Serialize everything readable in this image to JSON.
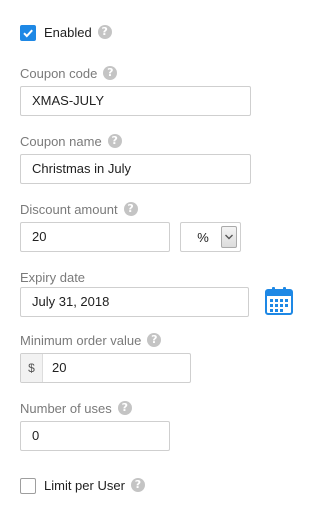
{
  "enabled": {
    "label": "Enabled",
    "checked": true
  },
  "coupon_code": {
    "label": "Coupon code",
    "value": "XMAS-JULY"
  },
  "coupon_name": {
    "label": "Coupon name",
    "value": "Christmas in July"
  },
  "discount_amount": {
    "label": "Discount amount",
    "value": "20",
    "type_selected": "%"
  },
  "expiry_date": {
    "label": "Expiry date",
    "value": "July 31, 2018"
  },
  "minimum_order_value": {
    "label": "Minimum order value",
    "currency_symbol": "$",
    "value": "20"
  },
  "number_of_uses": {
    "label": "Number of uses",
    "value": "0"
  },
  "limit_per_user": {
    "label": "Limit per User",
    "checked": false
  },
  "help_glyph": "?",
  "colors": {
    "accent": "#1e88e5",
    "label": "#7a7a7a",
    "border": "#cfcfcf",
    "help_icon": "#c4c4c4"
  }
}
